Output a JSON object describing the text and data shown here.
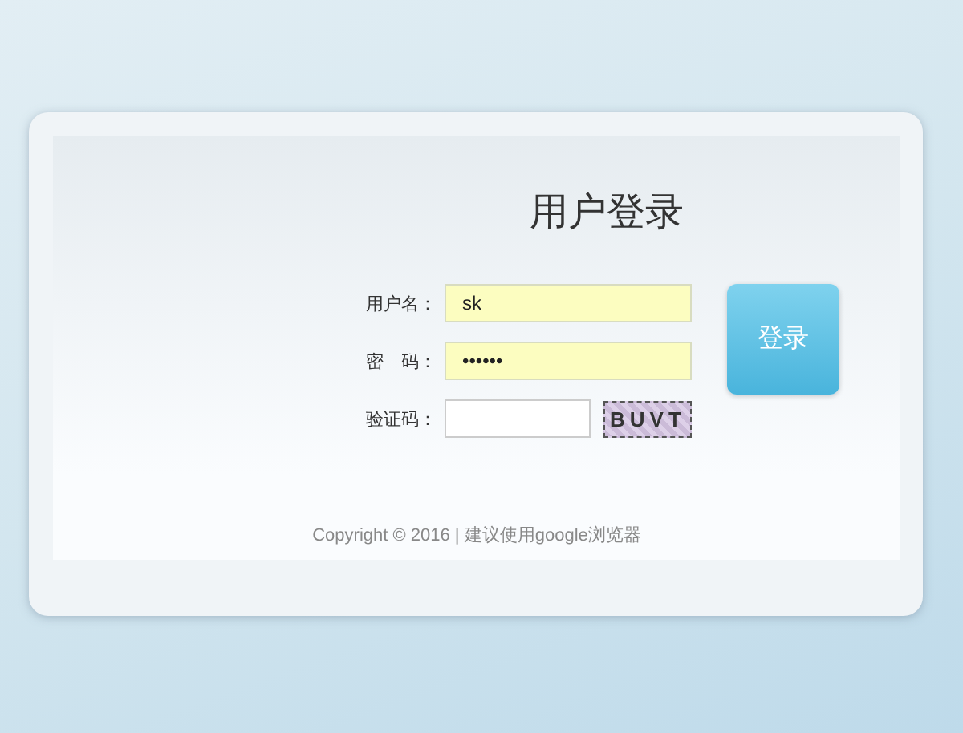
{
  "title": "用户登录",
  "fields": [
    {
      "label": "用户名：",
      "value": "sk",
      "kind": "text"
    },
    {
      "label": "密　码：",
      "value": "••••••",
      "kind": "text"
    },
    {
      "label": "验证码：",
      "kind": "captcha",
      "captcha": "BUVT"
    }
  ],
  "login_button": "登录",
  "footer": "Copyright © 2016 | 建议使用google浏览器"
}
